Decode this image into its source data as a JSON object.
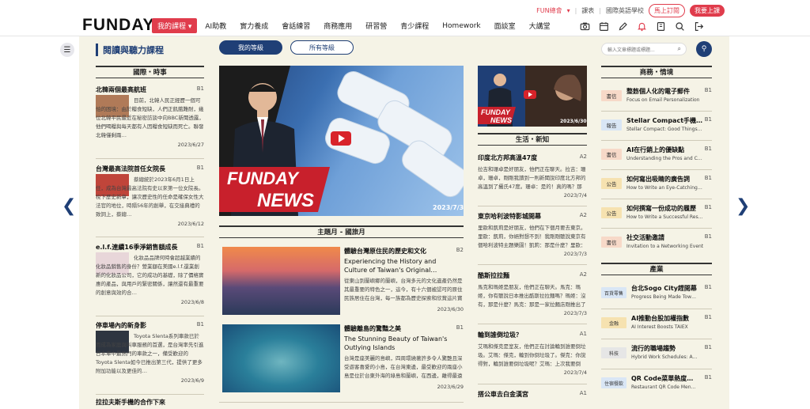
{
  "brand": {
    "logo": "FUNDAY"
  },
  "util": {
    "channel": "FUN總會",
    "catalog": "課表",
    "school": "國際英語學校",
    "subscribe": "馬上訂閱",
    "signup": "我要上課"
  },
  "nav": {
    "items": [
      {
        "label": "我的課程 ▾",
        "active": true
      },
      {
        "label": "AI助教"
      },
      {
        "label": "實力養成"
      },
      {
        "label": "會話練習"
      },
      {
        "label": "商務應用"
      },
      {
        "label": "研習營"
      },
      {
        "label": "青少課程"
      },
      {
        "label": "Homework"
      },
      {
        "label": "面談室"
      },
      {
        "label": "大講堂"
      }
    ]
  },
  "tools": [
    "camera-icon",
    "calendar-icon",
    "pen-icon",
    "bell-icon",
    "bookmark-icon",
    "search-icon",
    "logout-icon"
  ],
  "page": {
    "title": "閱讀與聽力課程",
    "tab_mine": "我的等級",
    "tab_all": "所有等級",
    "search_placeholder": "輸入文章標題或標題..."
  },
  "col1": {
    "header": "國際・時事",
    "articles": [
      {
        "title": "北韓兩個最高航班",
        "level": "B1",
        "body": "目前，北韓人民正經歷一個可怕的困境：由於糧食短缺，人們正飢餓難耐，幾位北韓平民最近在秘密訪談中向BBC新聞透露，他們喝糧與每天都有人因糧食短缺而死亡。聯發北韓僅剩兩…",
        "date": "2023/6/27",
        "thumb": "#b07a58"
      },
      {
        "title": "台灣最高法院首任女院長",
        "level": "B1",
        "body": "蔡總統於2023年6月1日上任，成為台灣最高法院有史以來第一位女院長。稅下歷史新章，讓次歷史性的任命是確保女性大法官的地位，時隔56年的創舉，在交接典禮的致詞上，蔡總…",
        "date": "2023/6/12",
        "thumb": "#c0453a"
      },
      {
        "title": "e.l.f.連續16季淨銷售額成長",
        "level": "B1",
        "body": "化妝品品牌何時會超越業績的化妝品銷售的身份？營業額在美國e.l.f.還業創新的化妝品公司，它的成功的基礎，除了價格實惠的產品，與用戶的緊密關係，讓然還有最重要的創意與效的合…",
        "date": "2023/6/8",
        "thumb": "#e8d6d9"
      },
      {
        "title": "停車場內的新身影",
        "level": "B1",
        "body": "Toyota Slenta系列車款已於而成為家庭與叫車服務的首選，是台灣率先引進日本車中最熱門的車款之一，備受歡迎的Toyota Slenta如今已推出第三代，提供了更多附加功能以及更佳的…",
        "date": "2023/6/9",
        "thumb": "#2e3540"
      }
    ]
  },
  "hero": {
    "brand": "FUNDAY",
    "sub": "NEWS",
    "date": "2023/7/3"
  },
  "feature": {
    "header": "主題月 - 國旅月",
    "items": [
      {
        "zh": "體驗台灣原住民的歷史和文化",
        "level": "B2",
        "en": "Experiencing the History and Culture of Taiwan's Original…",
        "body": "從東山到蘭嶼鄉的蘭嶼，台灣多元的文化遺產仍然是其最重要的特色之一，這今，有十六個被認可的原住民族居住在台灣，每一族都為歷史探索和欣賞這片寶島的多元原住…",
        "date": "2023/6/30"
      },
      {
        "zh": "體驗離島的驚豔之美",
        "level": "B1",
        "en": "The Stunning Beauty of Taiwan's Outlying Islands",
        "body": "台灣是座美麗的島嶼，四周環繞著許多令人驚艷且深受遊客喜愛的小島，在台灣東邊，最受歡迎的兩座小島是位於台東外海的綠島和蘭嶼，在西邊，離得最遠的島嶼…",
        "date": "2023/6/29"
      }
    ]
  },
  "col3": {
    "thumb_brand": "FUNDAY",
    "thumb_sub": "NEWS",
    "thumb_date": "2023/6/30",
    "header": "生活・新知",
    "articles": [
      {
        "title": "印度北方邦高溫47度",
        "level": "A2",
        "body": "拉吉和珊卓是好朋友，他們正在聊天。拉吉：珊卓，珊卓，剛剛我讀到一則新聞說印度北方邦的高溫到了攝氏47度。珊卓：是的！真的嗎？那他們那很熱吧？拉吉：情況很嚴重…",
        "date": "2023/7/4"
      },
      {
        "title": "東京哈利波特影城開幕",
        "level": "A2",
        "body": "里歐和凱莉是好朋友，他們在下個月要去東京。里歐：凱莉，你絕對想不到！我剛剛聽說東京有個哈利波特主題樂園！凱莉：那是什麼？里歐：它…",
        "date": "2023/7/3"
      },
      {
        "title": "酷斯拉拉麵",
        "level": "A2",
        "body": "馬克和瑪姬是朋友，他們正在聊天。馬克：瑪姬，你有聽說日本推出酷斯拉拉麵嗎？瑪姬：沒有，那是什麼？馬克：那是一家拉麵店剛推出了一個…",
        "date": "2023/7/3"
      },
      {
        "title": "輪到誰倒垃圾？",
        "level": "A1",
        "body": "艾瑪和傑克是室友，他們正在討論輪到誰要倒垃圾。艾瑪：傑克，輪到你倒垃圾了。傑克：你說得對，輪到誰要倒垃圾呢？艾瑪：上次我要倒的，所以這次輪到你了…",
        "date": "2023/7/4"
      },
      {
        "title": "搭公車去白金漢宮",
        "level": "A1",
        "body": "",
        "date": ""
      }
    ]
  },
  "col4": {
    "header": "商務・情境",
    "business": [
      {
        "badge": "書信",
        "zh": "整飭個人化的電子郵件",
        "level": "B1",
        "en": "Focus on Email Personalization"
      },
      {
        "badge": "報告",
        "zh": "Stellar Compact手機…",
        "level": "B1",
        "en": "Stellar Compact: Good Things…"
      },
      {
        "badge": "書信",
        "zh": "AI在行銷上的優缺點",
        "level": "B1",
        "en": "Understanding the Pros and C…"
      },
      {
        "badge": "公告",
        "zh": "如何寫出吸睛的廣告詞",
        "level": "B1",
        "en": "How to Write an Eye-Catching…"
      },
      {
        "badge": "公告",
        "zh": "如何撰寫一份成功的履歷",
        "level": "B1",
        "en": "How to Write a Successful Res…"
      },
      {
        "badge": "書信",
        "zh": "社交活動邀請",
        "level": "B1",
        "en": "Invitation to a Networking Event"
      }
    ],
    "industry_header": "產業",
    "industry": [
      {
        "badge": "百貨零售",
        "zh": "台北Sogo City趕開幕",
        "level": "B1",
        "en": "Progress Being Made Tow…"
      },
      {
        "badge": "金融",
        "zh": "AI推動台股加權指數",
        "level": "B1",
        "en": "AI Interest Boosts TAIEX"
      },
      {
        "badge": "科技",
        "zh": "流行的職場趨勢",
        "level": "B1",
        "en": "Hybrid Work Schedules: A…"
      },
      {
        "badge": "住宿餐飲",
        "zh": "QR Code菜單熱度…",
        "level": "B1",
        "en": "Restaurant QR Code Men…"
      }
    ]
  },
  "partial_title": "拉拉夫斯手機的合作下來"
}
